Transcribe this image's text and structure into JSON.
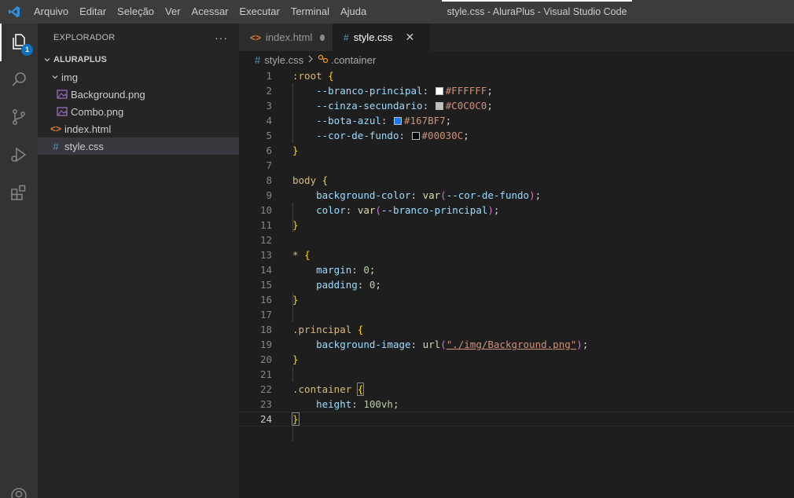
{
  "titlebar": {
    "menu": [
      "Arquivo",
      "Editar",
      "Seleção",
      "Ver",
      "Acessar",
      "Executar",
      "Terminal",
      "Ajuda"
    ],
    "window_title": "style.css - AluraPlus - Visual Studio Code"
  },
  "activity": {
    "badge": "1",
    "items": [
      "explorer-icon",
      "search-icon",
      "source-control-icon",
      "run-debug-icon",
      "extensions-icon",
      "account-icon"
    ]
  },
  "sidebar": {
    "title": "EXPLORADOR",
    "more": "···",
    "project": "ALURAPLUS",
    "folder": "img",
    "files": {
      "background": "Background.png",
      "combo": "Combo.png",
      "index": "index.html",
      "style": "style.css"
    }
  },
  "tabs": {
    "index": "index.html",
    "style": "style.css",
    "close": "✕"
  },
  "breadcrumb": {
    "file": "style.css",
    "symbol": ".container"
  },
  "code": {
    "line_numbers": [
      "1",
      "2",
      "3",
      "4",
      "5",
      "6",
      "7",
      "8",
      "9",
      "10",
      "11",
      "12",
      "13",
      "14",
      "15",
      "16",
      "17",
      "18",
      "19",
      "20",
      "21",
      "22",
      "23",
      "24"
    ],
    "root_sel": ":root",
    "vars": [
      {
        "name": "--branco-principal",
        "value": "#FFFFFF",
        "color": "#FFFFFF"
      },
      {
        "name": "--cinza-secundario",
        "value": "#C0C0C0",
        "color": "#C0C0C0"
      },
      {
        "name": "--bota-azul",
        "value": "#167BF7",
        "color": "#167BF7"
      },
      {
        "name": "--cor-de-fundo",
        "value": "#00030C",
        "color": "#00030C"
      }
    ],
    "body_sel": "body",
    "body_bg_prop": "background-color",
    "body_bg_var": "--cor-de-fundo",
    "body_color_prop": "color",
    "body_color_var": "--branco-principal",
    "star_sel": "*",
    "margin_prop": "margin",
    "margin_val": "0",
    "padding_prop": "padding",
    "padding_val": "0",
    "principal_sel": ".principal",
    "bgimg_prop": "background-image",
    "bgimg_url": "\"./img/Background.png\"",
    "container_sel": ".container",
    "height_prop": "height",
    "height_val": "100vh"
  }
}
